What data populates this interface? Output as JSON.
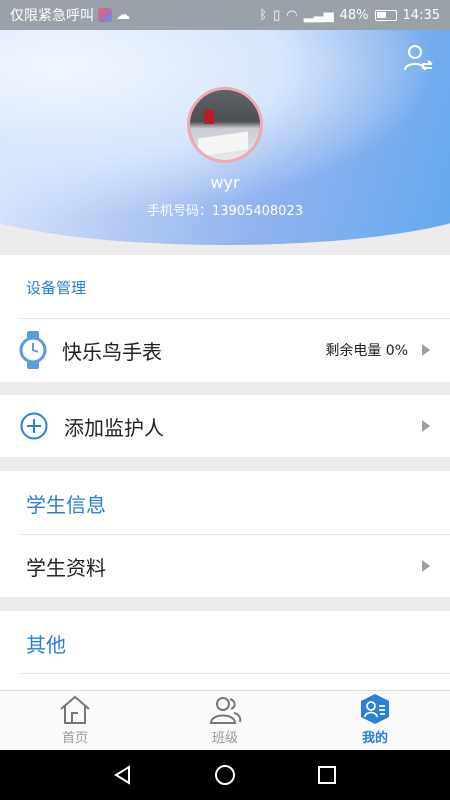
{
  "status_bar": {
    "carrier_text": "仅限紧急呼叫",
    "battery": "48%",
    "time": "14:35"
  },
  "profile": {
    "name": "wyr",
    "phone_label": "手机号码：",
    "phone_number": "13905408023"
  },
  "device_section": {
    "title": "设备管理",
    "device_name": "快乐鸟手表",
    "battery_label": "剩余电量",
    "battery_value": "0%"
  },
  "guardian": {
    "add_label": "添加监护人"
  },
  "student_section": {
    "title": "学生信息",
    "item_label": "学生资料"
  },
  "other_section": {
    "title": "其他"
  },
  "tabs": [
    {
      "label": "首页",
      "icon": "home-icon"
    },
    {
      "label": "班级",
      "icon": "class-icon"
    },
    {
      "label": "我的",
      "icon": "profile-icon"
    }
  ],
  "colors": {
    "accent": "#2a7fd8"
  }
}
